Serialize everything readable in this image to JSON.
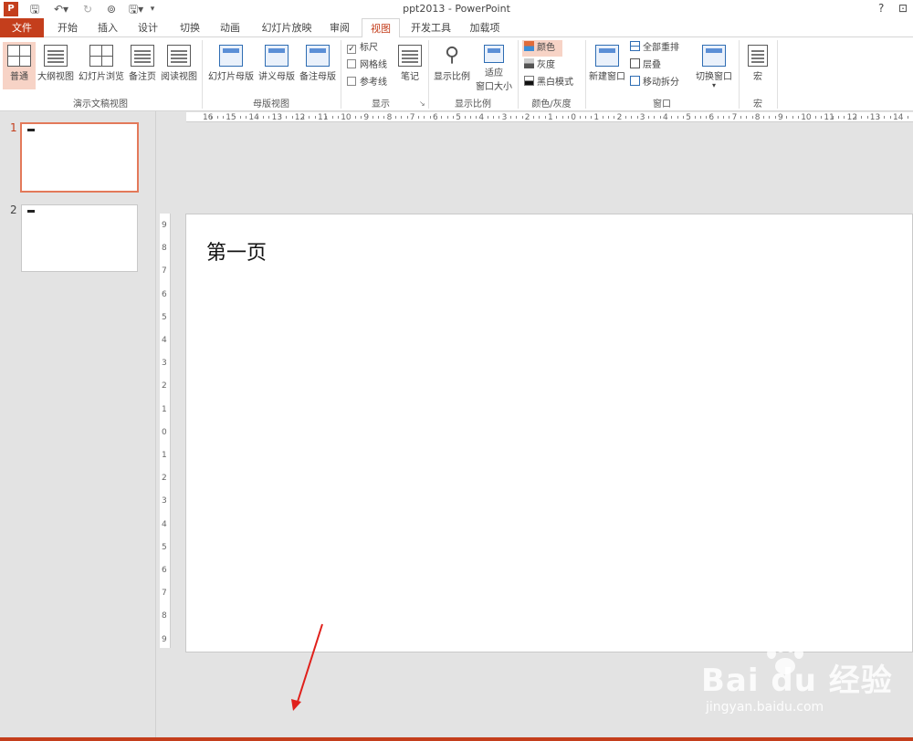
{
  "window": {
    "title": "ppt2013 - PowerPoint",
    "help": "?",
    "restore": "⊡"
  },
  "tabs": [
    "文件",
    "开始",
    "插入",
    "设计",
    "切换",
    "动画",
    "幻灯片放映",
    "审阅",
    "视图",
    "开发工具",
    "加载项"
  ],
  "ribbon": {
    "presentation_views": {
      "label": "演示文稿视图",
      "buttons": [
        "普通",
        "大纲视图",
        "幻灯片浏览",
        "备注页",
        "阅读视图"
      ]
    },
    "master_views": {
      "label": "母版视图",
      "buttons": [
        "幻灯片母版",
        "讲义母版",
        "备注母版"
      ]
    },
    "show": {
      "label": "显示",
      "checks": [
        {
          "label": "标尺",
          "checked": true
        },
        {
          "label": "网格线",
          "checked": false
        },
        {
          "label": "参考线",
          "checked": false
        }
      ],
      "notes": "笔记"
    },
    "zoom": {
      "label": "显示比例",
      "zoom_btn": "显示比例",
      "fit_line1": "适应",
      "fit_line2": "窗口大小"
    },
    "color": {
      "label": "颜色/灰度",
      "options": [
        "颜色",
        "灰度",
        "黑白模式"
      ]
    },
    "window_group": {
      "label": "窗口",
      "new_window": "新建窗口",
      "arrange_all": "全部重排",
      "cascade": "层叠",
      "move_split": "移动拆分",
      "switch_windows": "切换窗口"
    },
    "macros": {
      "label": "宏",
      "button": "宏"
    }
  },
  "slides": [
    {
      "number": "1",
      "selected": true
    },
    {
      "number": "2",
      "selected": false
    }
  ],
  "hruler_ticks": [
    "16",
    "15",
    "14",
    "13",
    "12",
    "11",
    "10",
    "9",
    "8",
    "7",
    "6",
    "5",
    "4",
    "3",
    "2",
    "1",
    "0",
    "1",
    "2",
    "3",
    "4",
    "5",
    "6",
    "7",
    "8",
    "9",
    "10",
    "11",
    "12",
    "13",
    "14"
  ],
  "vruler_ticks": [
    "9",
    "8",
    "7",
    "6",
    "5",
    "4",
    "3",
    "2",
    "1",
    "0",
    "1",
    "2",
    "3",
    "4",
    "5",
    "6",
    "7",
    "8",
    "9"
  ],
  "slide_title": "第一页",
  "watermark": {
    "logo": "Bai du 经验",
    "url": "jingyan.baidu.com"
  },
  "colors": {
    "accent": "#c43e1c",
    "selection": "#e3795a",
    "active_fill": "#f7d3c6"
  }
}
